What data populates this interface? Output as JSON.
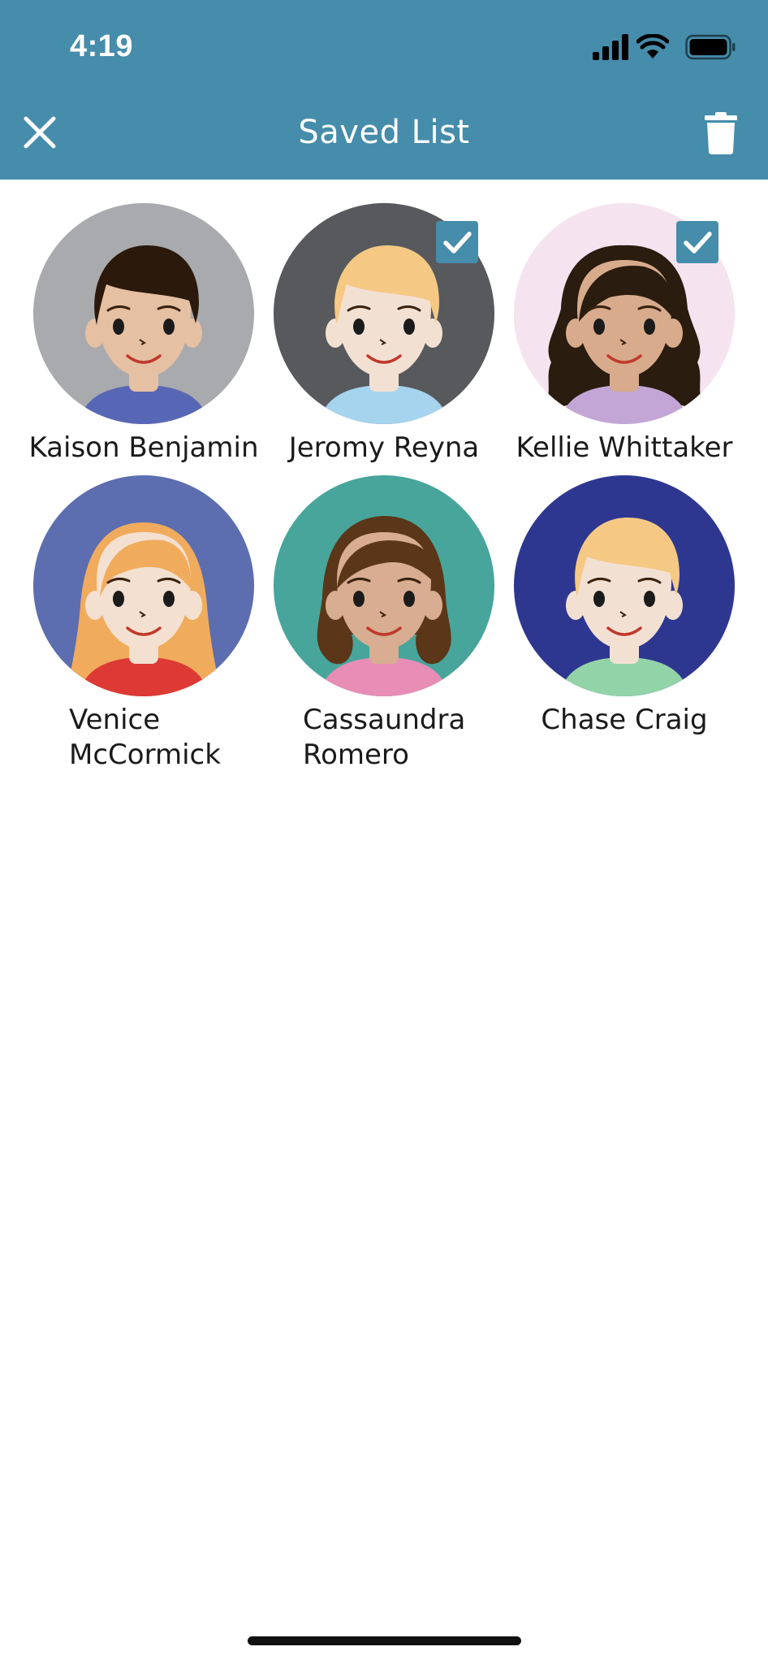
{
  "status_bar": {
    "time": "4:19",
    "icons": [
      "signal-icon",
      "wifi-icon",
      "battery-icon"
    ]
  },
  "nav": {
    "title": "Saved List",
    "close_icon": "close-icon",
    "delete_icon": "trash-icon"
  },
  "colors": {
    "accent": "#468cab",
    "background": "#ffffff",
    "text": "#1a1a1a"
  },
  "people": [
    {
      "name": "Kaison Benjamin",
      "selected": false,
      "bg": "#a9aaad",
      "hair": "#2b1a0c",
      "skin": "#e6c0a3",
      "shirt": "#5867b5",
      "hair_style": "short"
    },
    {
      "name": "Jeromy Reyna",
      "selected": true,
      "bg": "#58595d",
      "hair": "#f5c984",
      "skin": "#f2e1d3",
      "shirt": "#a6d4ef",
      "hair_style": "short"
    },
    {
      "name": "Kellie Whittaker",
      "selected": true,
      "bg": "#f5e3f0",
      "hair": "#2a1c0e",
      "skin": "#d7ab8c",
      "shirt": "#c3a6d6",
      "hair_style": "wavy"
    },
    {
      "name": "Venice McCormick",
      "selected": false,
      "bg": "#5c6eb0",
      "hair": "#f0ab5c",
      "skin": "#f3e0d0",
      "shirt": "#dd3a35",
      "hair_style": "long"
    },
    {
      "name": "Cassaundra Romero",
      "selected": false,
      "bg": "#47a59b",
      "hair": "#5b3618",
      "skin": "#d8ad91",
      "shirt": "#e88db5",
      "hair_style": "bob"
    },
    {
      "name": "Chase Craig",
      "selected": false,
      "bg": "#2e3790",
      "hair": "#f5c984",
      "skin": "#f2e1d3",
      "shirt": "#93d3a8",
      "hair_style": "short"
    }
  ]
}
